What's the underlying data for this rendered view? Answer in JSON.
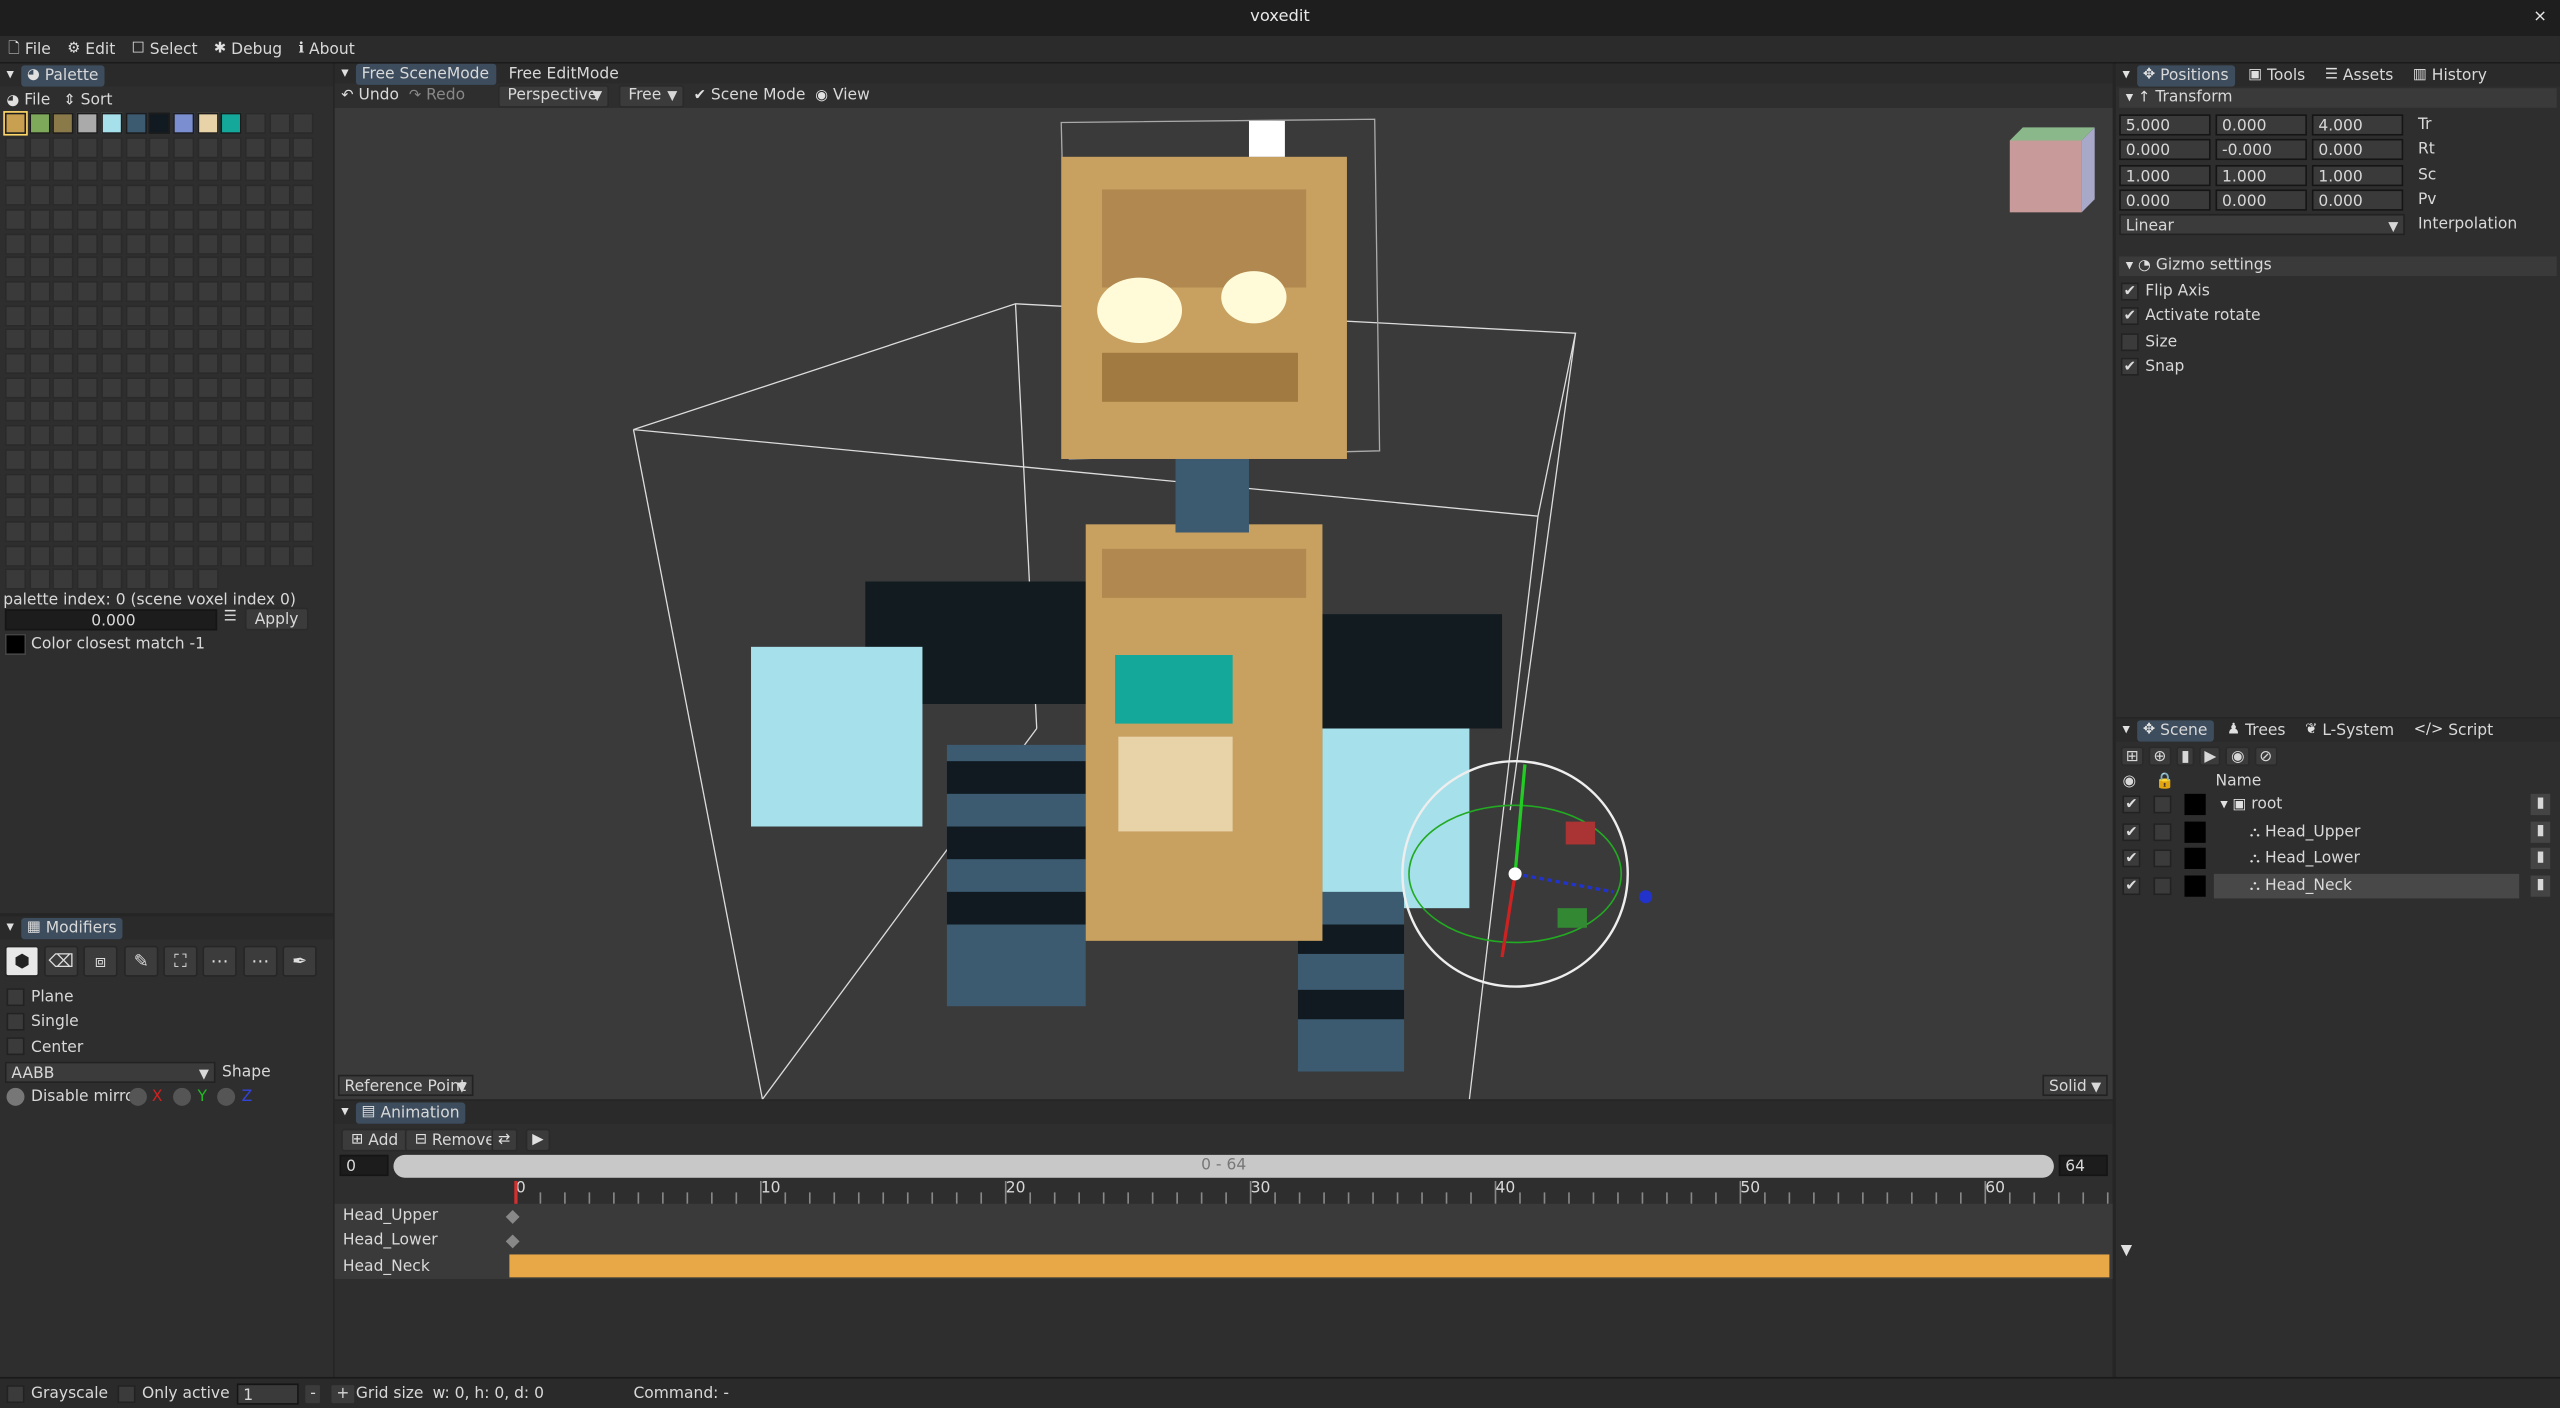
{
  "app": {
    "title": "voxedit",
    "close": "×"
  },
  "menu": [
    {
      "icon": "file-icon",
      "glyph": "🗋",
      "label": "File"
    },
    {
      "icon": "gear-icon",
      "glyph": "⚙",
      "label": "Edit"
    },
    {
      "icon": "select-icon",
      "glyph": "☐",
      "label": "Select"
    },
    {
      "icon": "bug-icon",
      "glyph": "✱",
      "label": "Debug"
    },
    {
      "icon": "info-icon",
      "glyph": "ℹ",
      "label": "About"
    }
  ],
  "palette": {
    "title": "Palette",
    "file": "File",
    "sort": "Sort",
    "colors": [
      "#c8a050",
      "#7ea85a",
      "#8a7a4a",
      "#aaaaaa",
      "#a6e0ea",
      "#3c5a70",
      "#101a20",
      "#7a8ed0",
      "#e8d2a8",
      "#14a89a"
    ],
    "index_text": "palette index: 0 (scene voxel index 0)",
    "value": "0.000",
    "apply": "Apply",
    "closest": "Color closest match -1"
  },
  "modifiers": {
    "title": "Modifiers",
    "tools": [
      "cube-icon",
      "eraser-icon",
      "override-icon",
      "brush-icon",
      "select-box-icon",
      "more-icon",
      "more-icon-2",
      "picker-icon"
    ],
    "options": [
      {
        "label": "Plane",
        "checked": false
      },
      {
        "label": "Single",
        "checked": false
      },
      {
        "label": "Center",
        "checked": false
      }
    ],
    "shape_value": "AABB",
    "shape_label": "Shape",
    "mirror_label": "Disable mirror",
    "axes": [
      "X",
      "Y",
      "Z"
    ]
  },
  "editor": {
    "tabs": [
      "Free SceneMode",
      "Free EditMode"
    ],
    "undo": "Undo",
    "redo": "Redo",
    "projection": "Perspective",
    "camera": "Free",
    "scene_mode": "Scene Mode",
    "view": "View",
    "reference": "Reference Point",
    "render": "Solid"
  },
  "animation": {
    "title": "Animation",
    "add": "Add",
    "remove": "Remove",
    "start": "0",
    "range": "0 - 64",
    "end": "64",
    "ticks": [
      "0",
      "10",
      "20",
      "30",
      "40",
      "50",
      "60"
    ],
    "tracks": [
      "Head_Upper",
      "Head_Lower",
      "Head_Neck"
    ]
  },
  "right_tabs": [
    "Positions",
    "Tools",
    "Assets",
    "History"
  ],
  "transform": {
    "title": "Transform",
    "rows": [
      {
        "values": [
          "5.000",
          "0.000",
          "4.000"
        ],
        "label": "Tr"
      },
      {
        "values": [
          "0.000",
          "-0.000",
          "0.000"
        ],
        "label": "Rt"
      },
      {
        "values": [
          "1.000",
          "1.000",
          "1.000"
        ],
        "label": "Sc"
      },
      {
        "values": [
          "0.000",
          "0.000",
          "0.000"
        ],
        "label": "Pv"
      }
    ],
    "interp_value": "Linear",
    "interp_label": "Interpolation"
  },
  "gizmo": {
    "title": "Gizmo settings",
    "options": [
      {
        "label": "Flip Axis",
        "checked": true
      },
      {
        "label": "Activate rotate",
        "checked": true
      },
      {
        "label": "Size",
        "checked": false
      },
      {
        "label": "Snap",
        "checked": true
      }
    ]
  },
  "scene_tabs": [
    "Scene",
    "Trees",
    "L-System",
    "Script"
  ],
  "scene": {
    "column": "Name",
    "nodes": [
      {
        "name": "root",
        "level": 0,
        "selected": false
      },
      {
        "name": "Head_Upper",
        "level": 1,
        "selected": false
      },
      {
        "name": "Head_Lower",
        "level": 1,
        "selected": false
      },
      {
        "name": "Head_Neck",
        "level": 1,
        "selected": true
      }
    ]
  },
  "status": {
    "grayscale": "Grayscale",
    "only_active": "Only active",
    "grid_value": "1",
    "minus": "-",
    "plus": "+",
    "grid_label": "Grid size",
    "dims": "w: 0, h: 0, d: 0",
    "command": "Command: -"
  }
}
